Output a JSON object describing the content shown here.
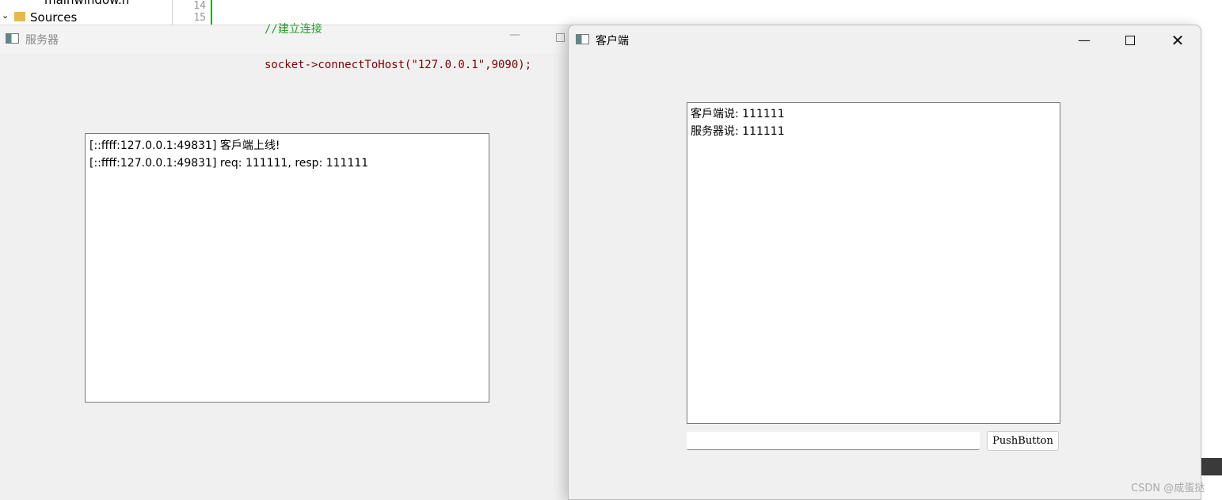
{
  "ide": {
    "tree_items": [
      "mainwindow.h",
      "Sources"
    ],
    "line_numbers": [
      "14",
      "15"
    ],
    "code_lines": [
      "//建立连接",
      "socket->connectToHost(\"127.0.0.1\",9090);"
    ]
  },
  "server": {
    "title": "服务器",
    "log": [
      "[::ffff:127.0.0.1:49831] 客戶端上线!",
      "[::ffff:127.0.0.1:49831] req: 111111, resp: 111111"
    ]
  },
  "client": {
    "title": "客户端",
    "log": [
      "客戶端说: 111111",
      "服务器说: 111111"
    ],
    "input_value": "",
    "button_label": "PushButton"
  },
  "watermark": "CSDN @咸蛋挞"
}
